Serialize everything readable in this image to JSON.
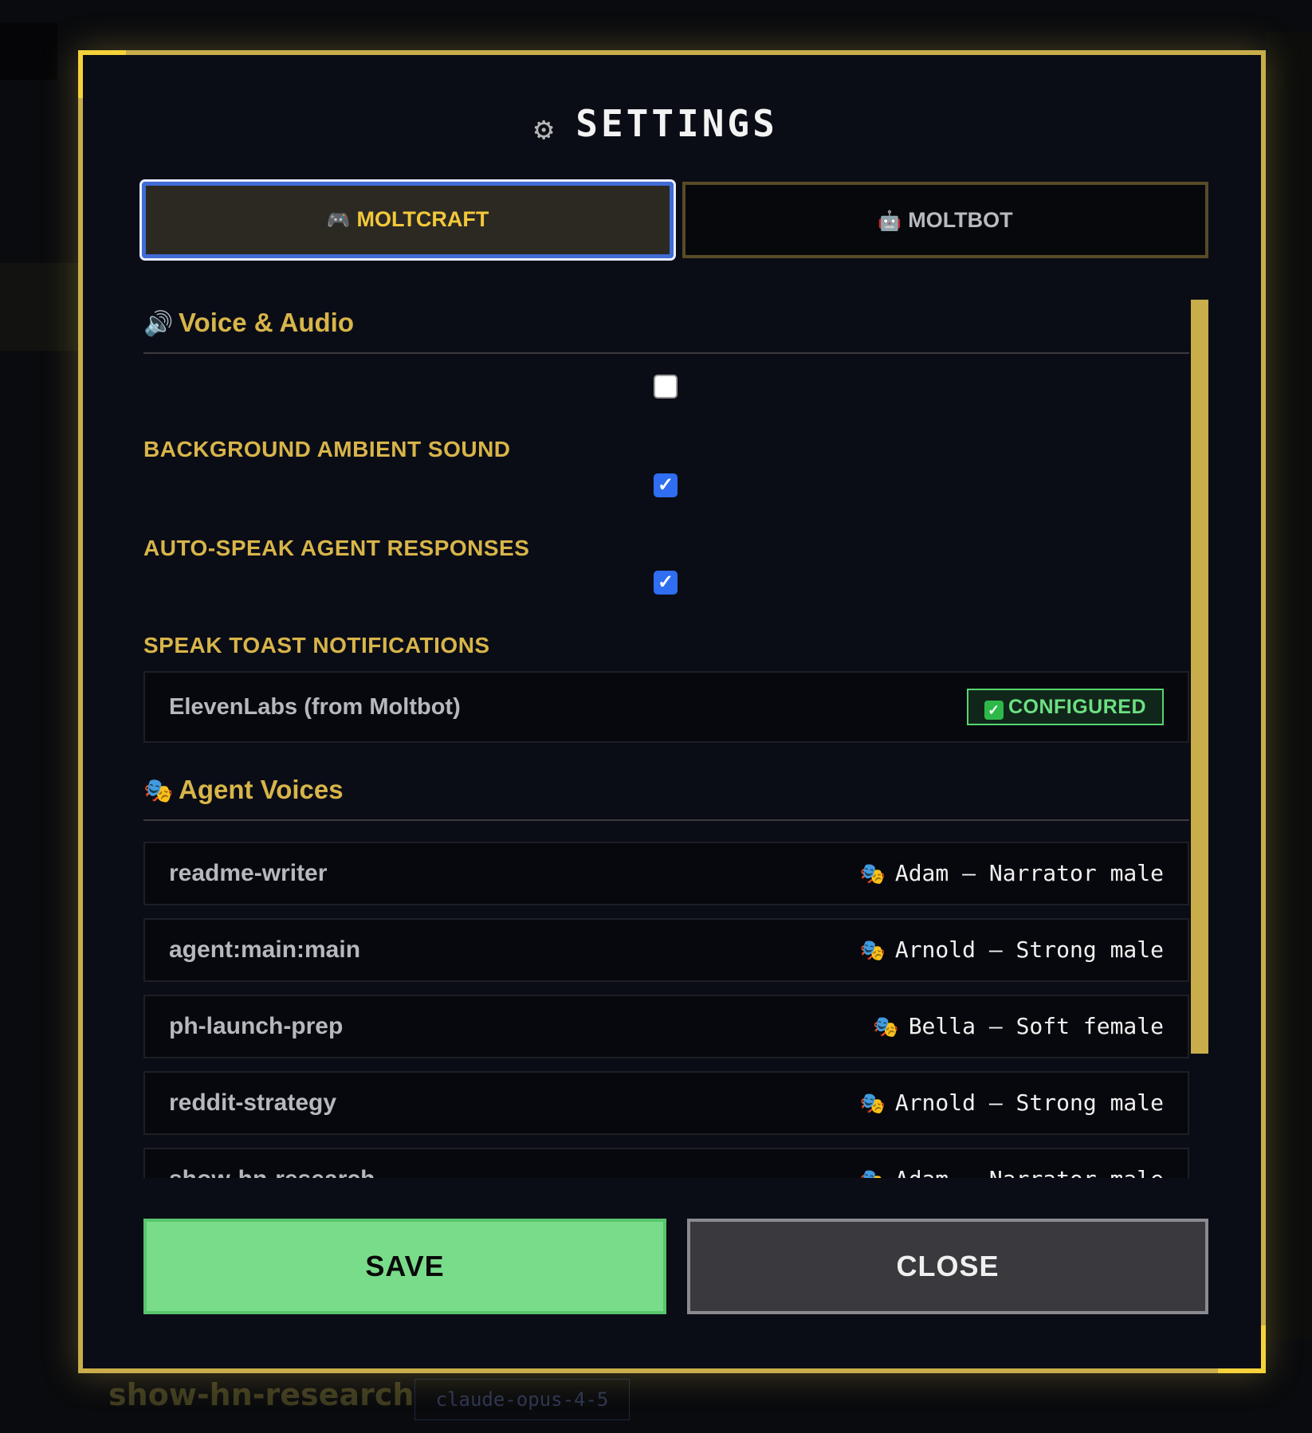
{
  "modal": {
    "title": "SETTINGS",
    "title_icon": "gear-icon"
  },
  "tabs": [
    {
      "label": "MOLTCRAFT",
      "icon": "gamepad-icon",
      "active": true
    },
    {
      "label": "MOLTBOT",
      "icon": "robot-icon",
      "active": false
    }
  ],
  "voice_audio": {
    "section_title": "Voice & Audio",
    "section_icon": "speaker-icon",
    "settings": [
      {
        "label": "BACKGROUND AMBIENT SOUND",
        "checked": false
      },
      {
        "label": "AUTO-SPEAK AGENT RESPONSES",
        "checked": true
      },
      {
        "label": "SPEAK TOAST NOTIFICATIONS",
        "checked": true
      }
    ],
    "provider": {
      "label": "ElevenLabs (from Moltbot)",
      "status": "CONFIGURED",
      "status_icon": "check-icon",
      "status_color": "#6ce083"
    }
  },
  "agent_voices": {
    "section_title": "Agent Voices",
    "section_icon": "theater-masks-icon",
    "rows": [
      {
        "agent": "readme-writer",
        "voice": "Adam — Narrator male"
      },
      {
        "agent": "agent:main:main",
        "voice": "Arnold — Strong male"
      },
      {
        "agent": "ph-launch-prep",
        "voice": "Bella — Soft female"
      },
      {
        "agent": "reddit-strategy",
        "voice": "Arnold — Strong male"
      },
      {
        "agent": "show-hn-research",
        "voice": "Adam — Narrator male"
      }
    ]
  },
  "footer": {
    "save_label": "SAVE",
    "close_label": "CLOSE"
  },
  "background": {
    "session_title": "show-hn-research",
    "model": "claude-opus-4-5"
  },
  "colors": {
    "accent_gold": "#c9ad4b",
    "label_gold": "#d8b54a",
    "save_green": "#79dc8b",
    "checkbox_blue": "#2f6df1",
    "panel_bg": "#0b0d16"
  }
}
